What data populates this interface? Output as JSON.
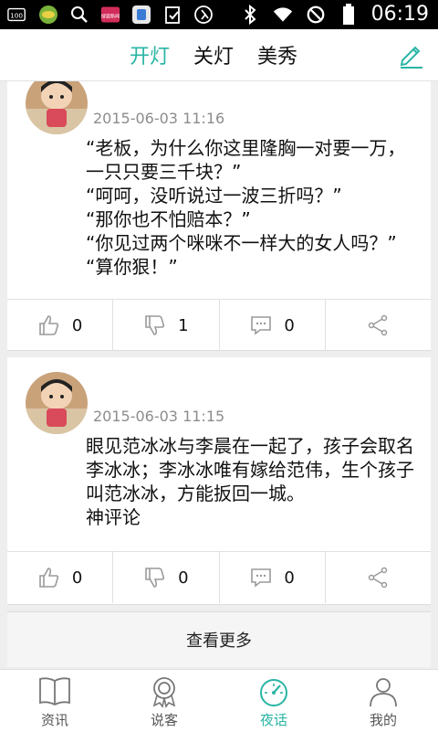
{
  "status_bar": {
    "time": "06:19",
    "left_icons": [
      "battery-100-icon",
      "game-app-icon",
      "search-icon",
      "news-app-icon",
      "security-app-icon",
      "clipboard-check-icon",
      "run-app-icon"
    ],
    "right_icons": [
      "bluetooth-icon",
      "wifi-icon",
      "do-not-disturb-icon",
      "battery-icon"
    ],
    "notification_badges": {
      "battery_text": "100",
      "news_app_text": "搜狐新闻"
    }
  },
  "header": {
    "tabs": [
      {
        "label": "开灯",
        "active": true
      },
      {
        "label": "关灯",
        "active": false
      },
      {
        "label": "美秀",
        "active": false
      }
    ],
    "accent_color": "#2ab5a5"
  },
  "posts": [
    {
      "time": "2015-06-03 11:16",
      "content": "“老板，为什么你这里隆胸一对要一万，一只只要三千块？”\n“呵呵，没听说过一波三折吗？”\n“那你也不怕赔本？”\n“你见过两个咪咪不一样大的女人吗？”\n“算你狠！”",
      "likes": "0",
      "dislikes": "1",
      "comments": "0"
    },
    {
      "time": "2015-06-03 11:15",
      "content": "眼见范冰冰与李晨在一起了，孩子会取名李冰冰；李冰冰唯有嫁给范伟，生个孩子叫范冰冰，方能扳回一城。\n神评论",
      "likes": "0",
      "dislikes": "0",
      "comments": "0"
    }
  ],
  "load_more_label": "查看更多",
  "bottom_nav": [
    {
      "label": "资讯",
      "icon": "book-icon",
      "active": false
    },
    {
      "label": "说客",
      "icon": "badge-icon",
      "active": false
    },
    {
      "label": "夜话",
      "icon": "speedometer-icon",
      "active": true
    },
    {
      "label": "我的",
      "icon": "person-icon",
      "active": false
    }
  ]
}
